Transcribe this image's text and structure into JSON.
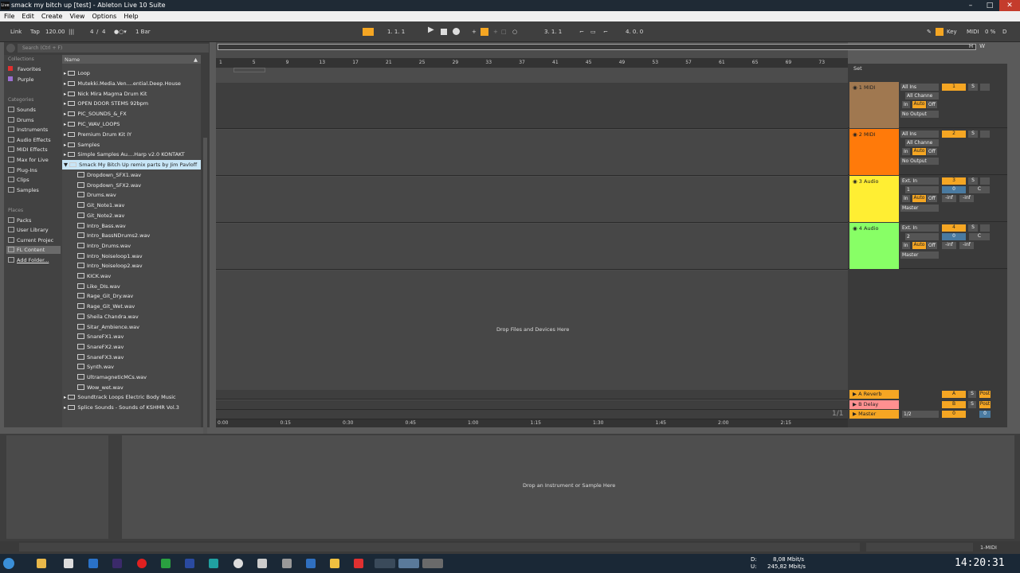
{
  "title": {
    "text": "smack my bitch up  [test] - Ableton Live 10 Suite",
    "badge": "Live"
  },
  "menu": [
    "File",
    "Edit",
    "Create",
    "View",
    "Options",
    "Help"
  ],
  "transport": {
    "link": "Link",
    "tap": "Tap",
    "tempo": "120.00",
    "time_sig_num": "4",
    "time_sig_den": "4",
    "quant": "1 Bar",
    "pos1": "1.   1.   1",
    "pos2": "3.   1.   1",
    "pos3": "4.   0.   0",
    "key": "Key",
    "midi": "MIDI",
    "cpu": "0 %",
    "d": "D"
  },
  "browser": {
    "search_placeholder": "Search (Ctrl + F)",
    "collections_header": "Collections",
    "favorites": "Favorites",
    "purple": "Purple",
    "categories_header": "Categories",
    "categories": [
      "Sounds",
      "Drums",
      "Instruments",
      "Audio Effects",
      "MIDI Effects",
      "Max for Live",
      "Plug-Ins",
      "Clips",
      "Samples"
    ],
    "places_header": "Places",
    "places": [
      "Packs",
      "User Library",
      "Current Projec",
      "FL Content",
      "Add Folder..."
    ],
    "name_header": "Name",
    "folders_top": [
      "Loop",
      "Mutekki.Media.Ven....ential.Deep.House",
      "Nick Mira Magma Drum Kit",
      "OPEN DOOR STEMS 92bpm",
      "PIC_SOUNDS_&_FX",
      "PIC_WAV_LOOPS",
      "Premium Drum Kit IY",
      "Samples",
      "Simple Samples Au....Harp v2.0 KONTAKT"
    ],
    "selected_folder": "Smack My Bitch Up remix parts by Jim Pavloff",
    "files": [
      "Dropdown_SFX1.wav",
      "Dropdown_SFX2.wav",
      "Drums.wav",
      "Git_Note1.wav",
      "Git_Note2.wav",
      "Intro_Bass.wav",
      "Intro_BassNDrums2.wav",
      "Intro_Drums.wav",
      "Intro_Noiseloop1.wav",
      "Intro_Noiseloop2.wav",
      "KICK.wav",
      "Like_DIs.wav",
      "Rage_Git_Dry.wav",
      "Rage_Git_Wet.wav",
      "Sheila Chandra.wav",
      "Sitar_Ambience.wav",
      "SnareFX1.wav",
      "SnareFX2.wav",
      "SnareFX3.wav",
      "Synth.wav",
      "UltramagneticMCs.wav",
      "Wow_wet.wav"
    ],
    "folders_bottom": [
      "Soundtrack Loops Electric Body Music",
      "Splice Sounds - Sounds of KSHMR Vol.3"
    ]
  },
  "arrangement": {
    "bars": [
      "1",
      "5",
      "9",
      "13",
      "17",
      "21",
      "25",
      "29",
      "33",
      "37",
      "41",
      "45",
      "49",
      "53",
      "57",
      "61",
      "65",
      "69",
      "73"
    ],
    "times": [
      "0:00",
      "0:15",
      "0:30",
      "0:45",
      "1:00",
      "1:15",
      "1:30",
      "1:45",
      "2:00",
      "2:15"
    ],
    "drop_text": "Drop Files and Devices Here",
    "page": "1/1",
    "set": "Set"
  },
  "tracks": [
    {
      "name": "1 MIDI",
      "color": "#a07850",
      "in": "All Ins",
      "ch": "All Channe",
      "out": "No Output",
      "num": "1"
    },
    {
      "name": "2 MIDI",
      "color": "#ff7a0a",
      "in": "All Ins",
      "ch": "All Channe",
      "out": "No Output",
      "num": "2"
    },
    {
      "name": "3 Audio",
      "color": "#ffee33",
      "in": "Ext. In",
      "ch": "1",
      "out": "Master",
      "num": "3"
    },
    {
      "name": "4 Audio",
      "color": "#88ff66",
      "in": "Ext. In",
      "ch": "2",
      "out": "Master",
      "num": "4"
    }
  ],
  "monitor": {
    "in": "In",
    "auto": "Auto",
    "off": "Off"
  },
  "mixer_vals": {
    "zero": "0",
    "c": "C",
    "inf": "-inf",
    "s": "S"
  },
  "returns": [
    {
      "name": "A Reverb",
      "color": "#f5a623",
      "letter": "A",
      "post": "Post"
    },
    {
      "name": "B Delay",
      "color": "#ff9090",
      "letter": "B",
      "post": "Post"
    },
    {
      "name": "Master",
      "color": "#f5a623",
      "letter": "0",
      "post": "0",
      "out": "1/2"
    }
  ],
  "detail": {
    "drop_text": "Drop an Instrument or Sample Here"
  },
  "status": {
    "track": "1-MIDI"
  },
  "taskbar": {
    "net1": "8,08 Mbit/s",
    "net2": "245,82 Mbit/s",
    "d": "D:",
    "u": "U:",
    "clock": "14:20:31"
  },
  "colors": {
    "accent": "#f5a623",
    "panel": "#3d3d3d"
  }
}
